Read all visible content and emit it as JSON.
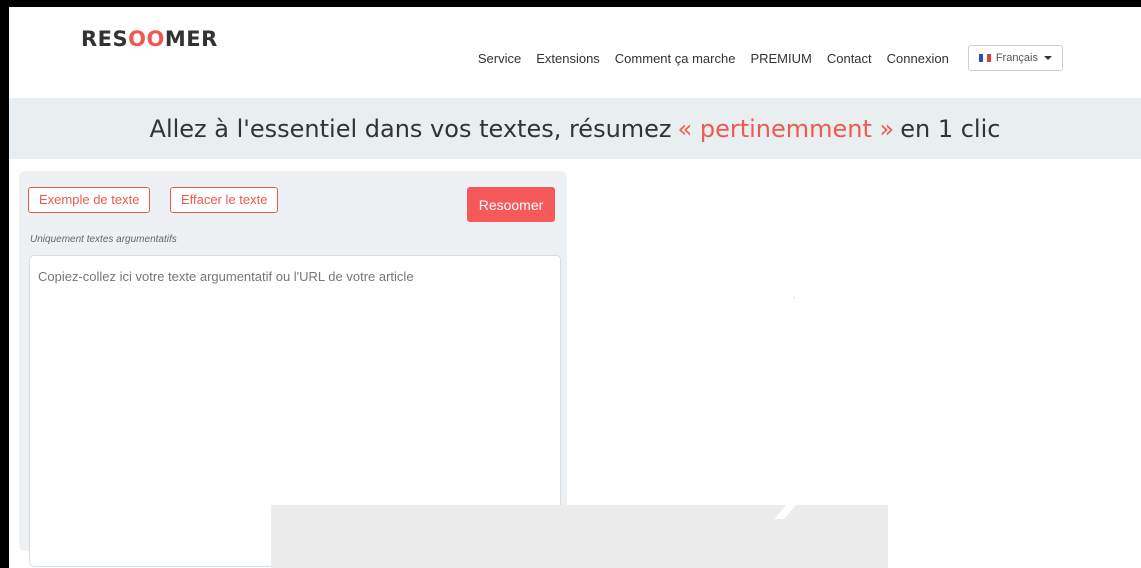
{
  "header": {
    "logo": {
      "part1": "RES",
      "part2": "OO",
      "part3": "MER"
    },
    "nav": [
      "Service",
      "Extensions",
      "Comment ça marche",
      "PREMIUM",
      "Contact",
      "Connexion"
    ],
    "language": {
      "label": "Français",
      "flag_colors": [
        "#2b4eb0",
        "#ffffff",
        "#e23b3b"
      ]
    }
  },
  "banner": {
    "before": "Allez à l'essentiel dans vos textes, résumez",
    "highlight": "« pertinemment »",
    "after": "en 1 clic"
  },
  "panel": {
    "example_button": "Exemple de texte",
    "clear_button": "Effacer le texte",
    "submit_button": "Resoomer",
    "hint": "Uniquement textes argumentatifs",
    "textarea_placeholder": "Copiez-collez ici votre texte argumentatif ou l'URL de votre article"
  },
  "colors": {
    "accent": "#ee5a4f",
    "banner_bg": "#e9eef1",
    "panel_bg": "#eef1f4"
  }
}
